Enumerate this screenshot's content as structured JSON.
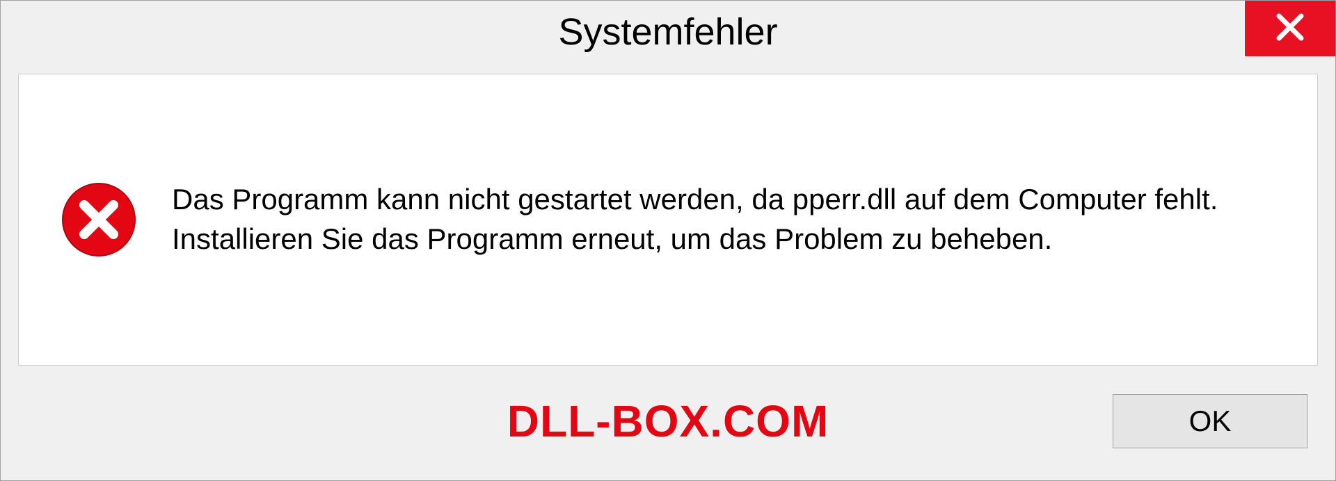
{
  "dialog": {
    "title": "Systemfehler",
    "message": "Das Programm kann nicht gestartet werden, da pperr.dll auf dem Computer fehlt. Installieren Sie das Programm erneut, um das Problem zu beheben.",
    "ok_label": "OK"
  },
  "watermark": "DLL-BOX.COM"
}
